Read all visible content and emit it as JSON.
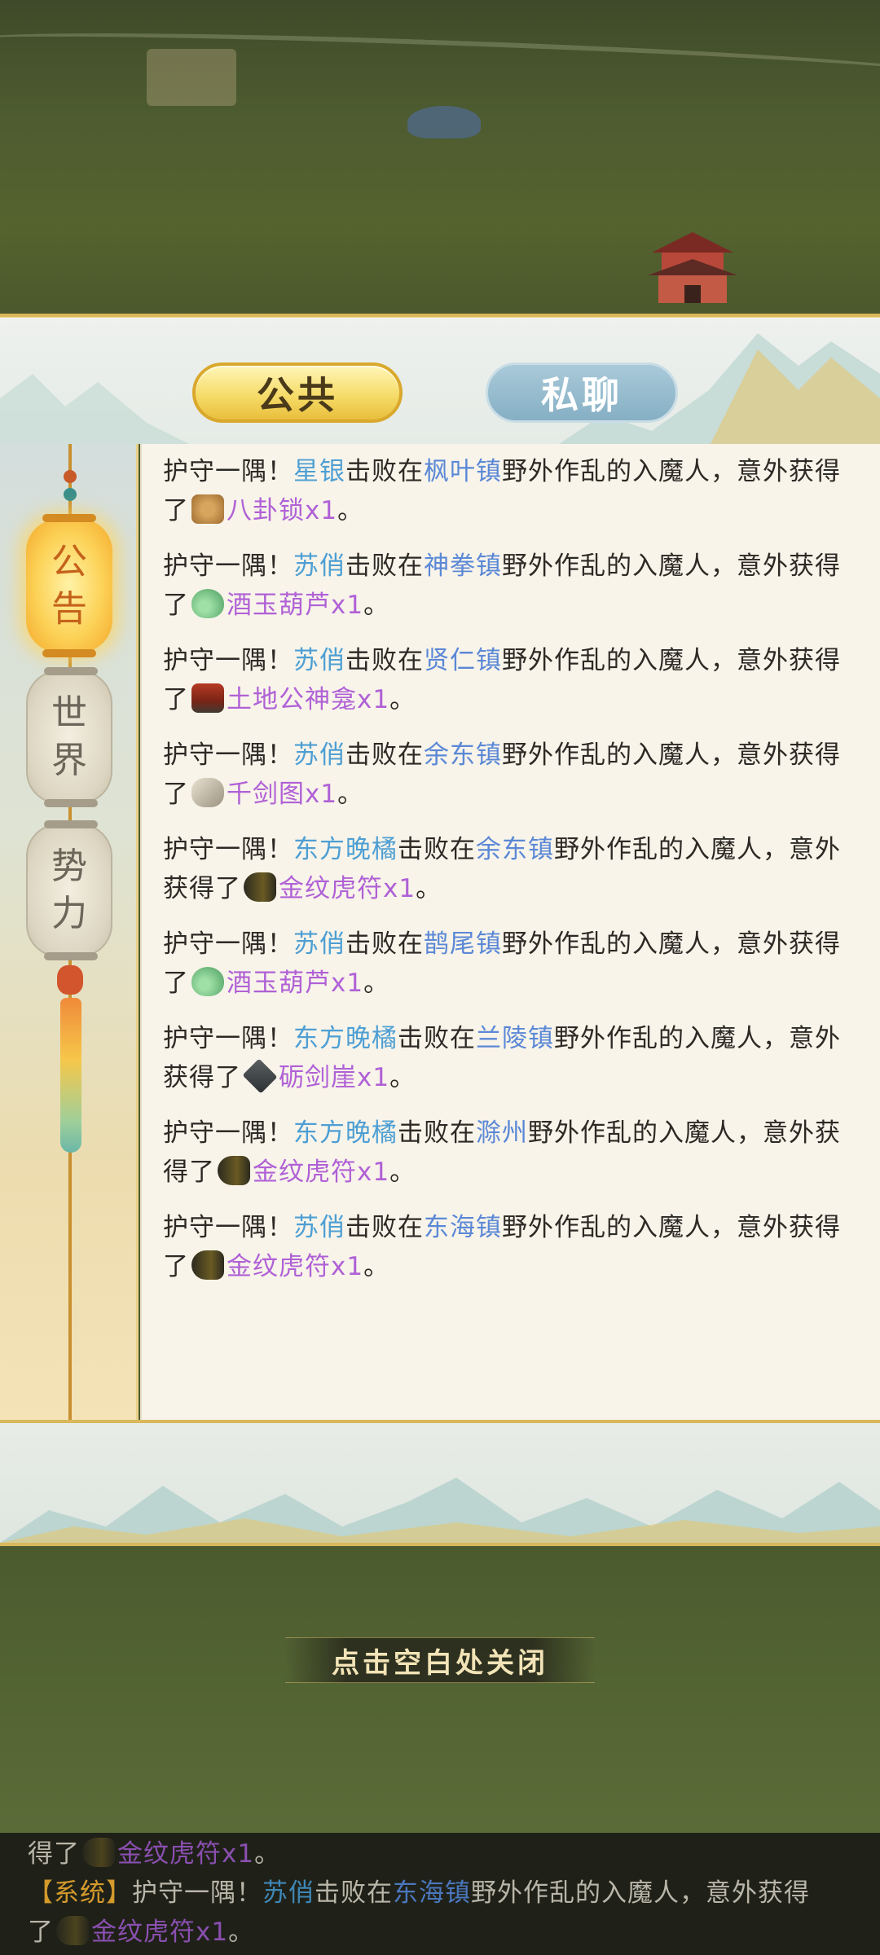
{
  "tabs": {
    "public": "公共",
    "private": "私聊"
  },
  "channels": [
    {
      "char1": "公",
      "char2": "告"
    },
    {
      "char1": "世",
      "char2": "界"
    },
    {
      "char1": "势",
      "char2": "力"
    }
  ],
  "messages": [
    {
      "prefix": "护守一隅！",
      "player": "星银",
      "mid": "击败在",
      "place": "枫叶镇",
      "suffix": "野外作乱的入魔人，意外获得了",
      "icon": "lock-icon",
      "item": "八卦锁x1",
      "end": "。"
    },
    {
      "prefix": "护守一隅！",
      "player": "苏俏",
      "mid": "击败在",
      "place": "神拳镇",
      "suffix": "野外作乱的入魔人，意外获得了",
      "icon": "gourd-icon",
      "item": "酒玉葫芦x1",
      "end": "。"
    },
    {
      "prefix": "护守一隅！",
      "player": "苏俏",
      "mid": "击败在",
      "place": "贤仁镇",
      "suffix": "野外作乱的入魔人，意外获得了",
      "icon": "shrine-icon",
      "item": "土地公神龛x1",
      "end": "。"
    },
    {
      "prefix": "护守一隅！",
      "player": "苏俏",
      "mid": "击败在",
      "place": "余东镇",
      "suffix": "野外作乱的入魔人，意外获得了",
      "icon": "scroll-icon",
      "item": "千剑图x1",
      "end": "。"
    },
    {
      "prefix": "护守一隅！",
      "player": "东方晚橘",
      "mid": "击败在",
      "place": "余东镇",
      "suffix": "野外作乱的入魔人，意外获得了",
      "icon": "tiger-tally-icon",
      "item": "金纹虎符x1",
      "end": "。"
    },
    {
      "prefix": "护守一隅！",
      "player": "苏俏",
      "mid": "击败在",
      "place": "鹊尾镇",
      "suffix": "野外作乱的入魔人，意外获得了",
      "icon": "gourd-icon",
      "item": "酒玉葫芦x1",
      "end": "。"
    },
    {
      "prefix": "护守一隅！",
      "player": "东方晚橘",
      "mid": "击败在",
      "place": "兰陵镇",
      "suffix": "野外作乱的入魔人，意外获得了",
      "icon": "cliff-icon",
      "item": "砺剑崖x1",
      "end": "。"
    },
    {
      "prefix": "护守一隅！",
      "player": "东方晚橘",
      "mid": "击败在",
      "place": "滁州",
      "suffix": "野外作乱的入魔人，意外获得了",
      "icon": "tiger-tally-icon",
      "item": "金纹虎符x1",
      "end": "。"
    },
    {
      "prefix": "护守一隅！",
      "player": "苏俏",
      "mid": "击败在",
      "place": "东海镇",
      "suffix": "野外作乱的入魔人，意外获得了",
      "icon": "tiger-tally-icon",
      "item": "金纹虎符x1",
      "end": "。"
    }
  ],
  "close_hint": "点击空白处关闭",
  "chat": {
    "line1_prefix": "得了",
    "line1_item": "金纹虎符x1",
    "line1_end": "。",
    "line2_tag": "【系统】",
    "line2_prefix": "护守一隅！",
    "line2_player": "苏俏",
    "line2_mid": "击败在",
    "line2_place": "东海镇",
    "line2_suffix": "野外作乱的入魔人，意外获得",
    "line3_prefix": "了",
    "line3_item": "金纹虎符x1",
    "line3_end": "。"
  },
  "colors": {
    "player": "#4e9fd3",
    "place": "#5b88d6",
    "item": "#b061d6",
    "system_tag": "#d59a2c",
    "gold_border": "#d9b75a"
  }
}
